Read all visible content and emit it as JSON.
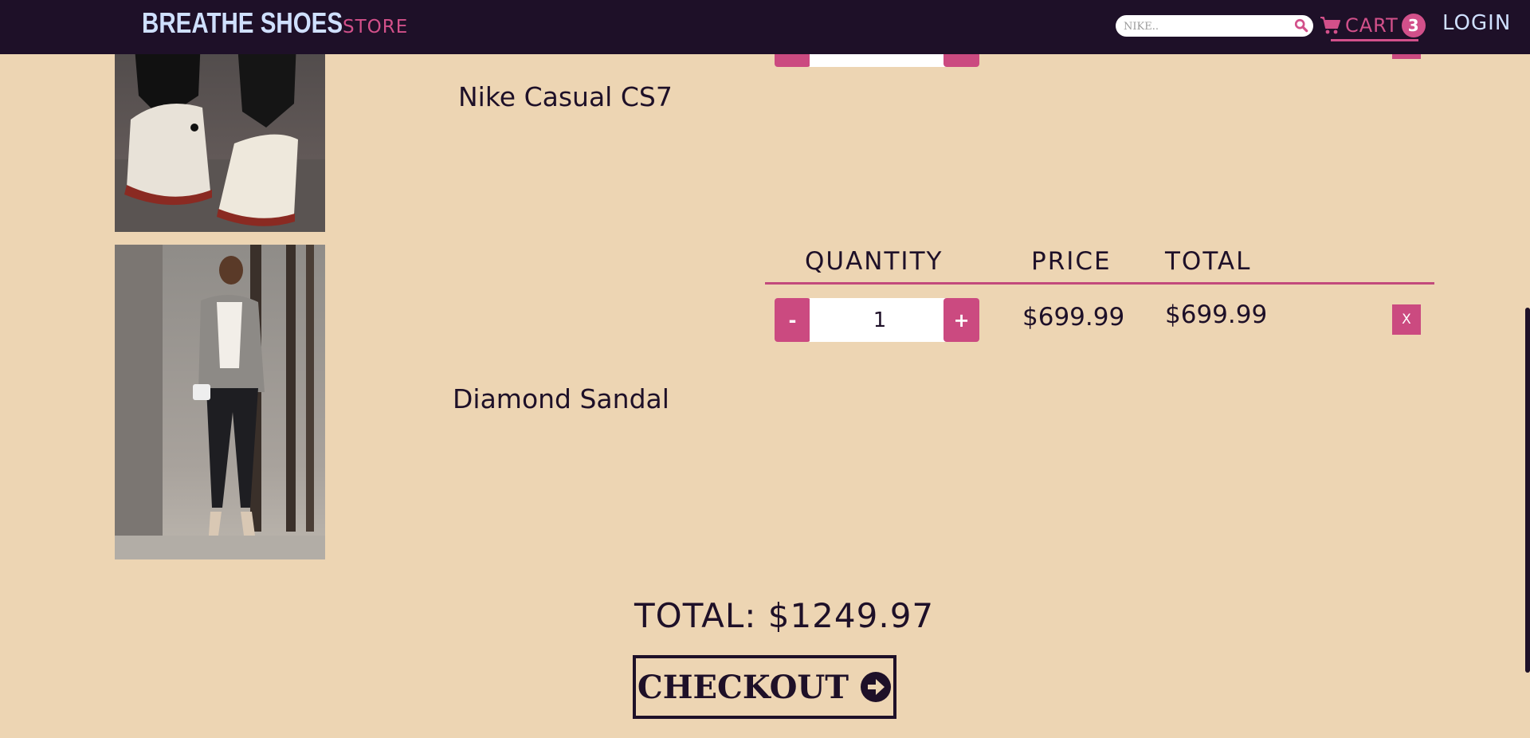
{
  "header": {
    "brand_name": "BREATHE SHOES",
    "brand_sub": "STORE",
    "search_placeholder": "NIKE..",
    "cart_label": "CART",
    "cart_count": "3",
    "login_label": "LOGIN"
  },
  "cart": {
    "column_headers": {
      "quantity": "QUANTITY",
      "price": "PRICE",
      "total": "TOTAL"
    },
    "items": [
      {
        "name": "Nike Casual CS7",
        "image_icon": "sneakers-photo",
        "minus_label": "-",
        "plus_label": "+",
        "remove_label": "X"
      },
      {
        "name": "Diamond Sandal",
        "image_icon": "woman-in-sandals-photo",
        "quantity": "1",
        "minus_label": "-",
        "plus_label": "+",
        "price": "$699.99",
        "total": "$699.99",
        "remove_label": "X"
      }
    ],
    "grand_total": "TOTAL: $1249.97",
    "checkout_label": "CHECKOUT"
  },
  "colors": {
    "navbar": "#1e1028",
    "page_bg": "#edd5b3",
    "accent": "#cb4a80",
    "brand": "#cfe0ff"
  }
}
